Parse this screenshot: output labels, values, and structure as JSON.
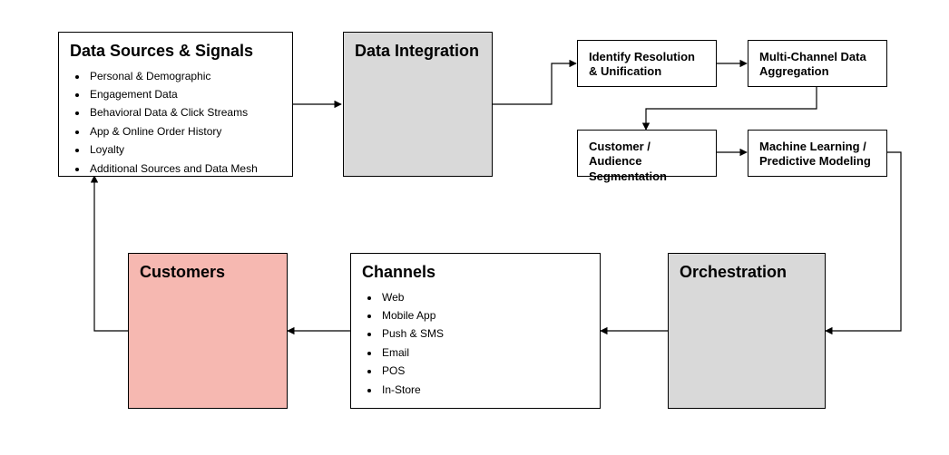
{
  "dataSources": {
    "title": "Data Sources & Signals",
    "items": [
      "Personal & Demographic",
      "Engagement Data",
      "Behavioral Data & Click Streams",
      "App & Online Order History",
      "Loyalty",
      "Additional Sources and Data Mesh"
    ]
  },
  "dataIntegration": {
    "title": "Data Integration"
  },
  "identifyResolution": {
    "title": "Identify Resolution & Unification"
  },
  "multiChannelAggregation": {
    "title": "Multi-Channel Data Aggregation"
  },
  "customerSegmentation": {
    "title": "Customer / Audience Segmentation"
  },
  "mlPredictive": {
    "title": "Machine Learning / Predictive Modeling"
  },
  "orchestration": {
    "title": "Orchestration"
  },
  "channels": {
    "title": "Channels",
    "items": [
      "Web",
      "Mobile App",
      "Push & SMS",
      "Email",
      "POS",
      "In-Store"
    ]
  },
  "customers": {
    "title": "Customers"
  },
  "colors": {
    "gray": "#d9d9d9",
    "pink": "#f6b8b1",
    "stroke": "#000000"
  }
}
